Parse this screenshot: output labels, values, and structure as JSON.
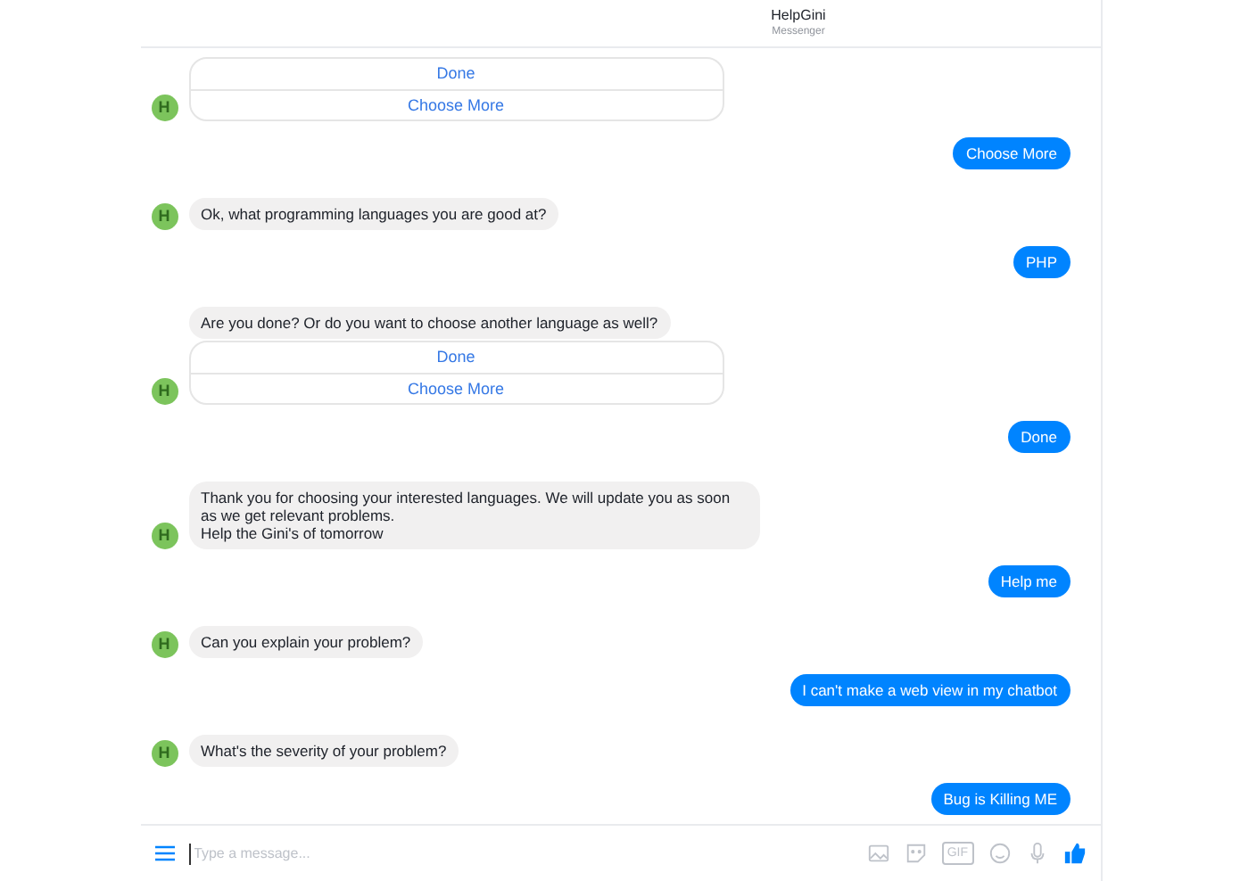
{
  "header": {
    "title": "HelpGini",
    "subtitle": "Messenger"
  },
  "messages": [
    {
      "kind": "quick_replies",
      "avatar": "H",
      "options": [
        "Done",
        "Choose More"
      ]
    },
    {
      "kind": "user",
      "text": "Choose More"
    },
    {
      "kind": "bot",
      "avatar": "H",
      "text": "Ok, what programming languages you are good at?"
    },
    {
      "kind": "user",
      "text": "PHP"
    },
    {
      "kind": "bot_with_replies",
      "avatar": "H",
      "text": "Are you done? Or do you want to choose another language as well?",
      "options": [
        "Done",
        "Choose More"
      ]
    },
    {
      "kind": "user",
      "text": "Done"
    },
    {
      "kind": "bot",
      "avatar": "H",
      "text": "Thank you for choosing your interested languages. We will update you as soon as we get relevant problems.\nHelp the Gini's of tomorrow"
    },
    {
      "kind": "user",
      "text": "Help me"
    },
    {
      "kind": "bot",
      "avatar": "H",
      "text": "Can you explain your problem?"
    },
    {
      "kind": "user",
      "text": "I can't make a web view in my chatbot"
    },
    {
      "kind": "bot",
      "avatar": "H",
      "text": "What's the severity of your problem?"
    },
    {
      "kind": "user",
      "text": "Bug is Killing ME"
    }
  ],
  "composer": {
    "placeholder": "Type a message...",
    "gif_label": "GIF"
  }
}
